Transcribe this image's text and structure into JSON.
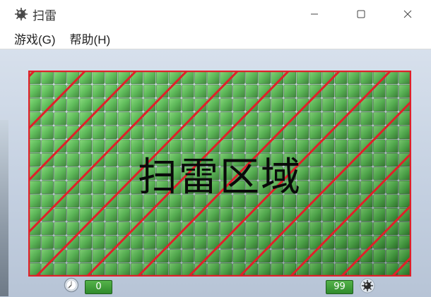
{
  "window": {
    "title": "扫雷",
    "app_icon": "mine-icon",
    "controls": [
      "minimize-icon",
      "maximize-icon",
      "close-icon"
    ]
  },
  "menu": {
    "items": [
      "游戏(G)",
      "帮助(H)"
    ]
  },
  "board": {
    "rows": 15,
    "cols": 30,
    "region_label": "扫雷区域",
    "tile_color": "#4fb84a",
    "outline_color": "#e0202a"
  },
  "status": {
    "timer_icon": "clock-icon",
    "timer_value": "0",
    "mines_value": "99",
    "mines_icon": "mine-icon"
  },
  "colors": {
    "accent_red": "#e0202a",
    "tile_green": "#4fb84a",
    "display_green": "#3c9a35"
  }
}
